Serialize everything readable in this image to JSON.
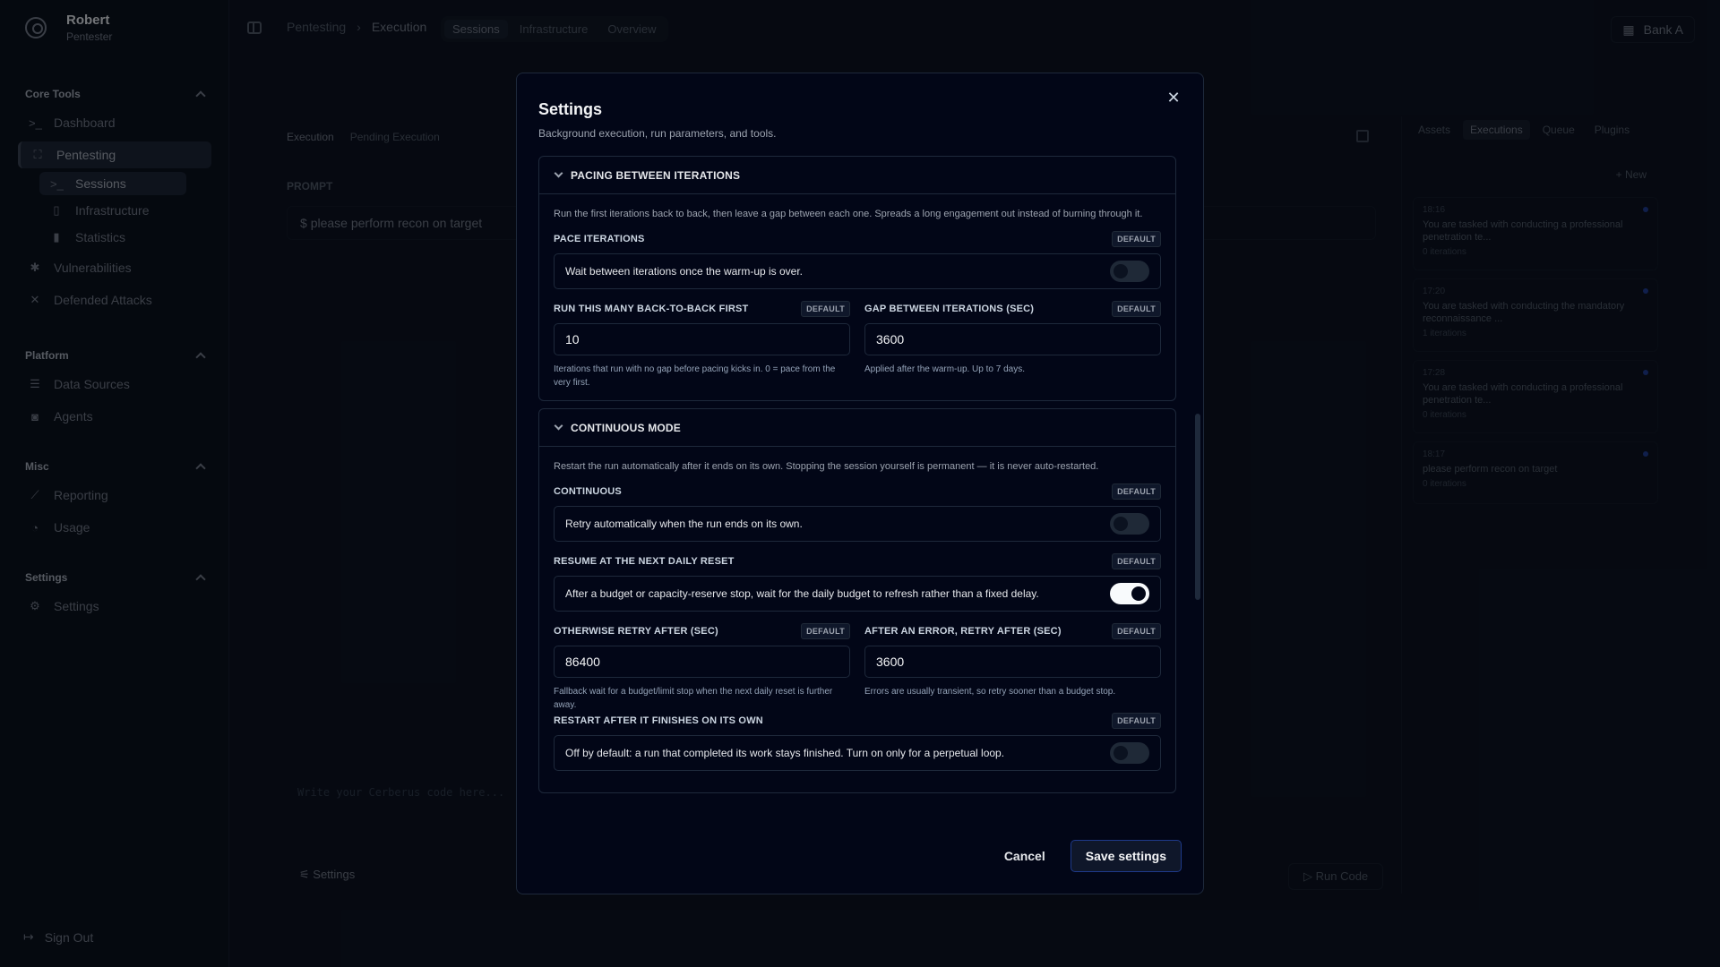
{
  "user": {
    "name": "Robert",
    "role": "Pentester"
  },
  "sidebar": {
    "core_tools": {
      "title": "Core Tools",
      "items": [
        "Dashboard",
        "Pentesting"
      ],
      "sub_items": [
        "Sessions",
        "Infrastructure",
        "Statistics"
      ],
      "more_items": [
        "Vulnerabilities",
        "Defended Attacks"
      ]
    },
    "platform": {
      "title": "Platform",
      "items": [
        "Data Sources",
        "Agents"
      ]
    },
    "misc": {
      "title": "Misc",
      "items": [
        "Reporting",
        "Usage"
      ]
    },
    "settings": {
      "title": "Settings",
      "items": [
        "Settings"
      ]
    },
    "sign_out": "Sign Out"
  },
  "topbar": {
    "breadcrumb": [
      "Pentesting",
      "Execution"
    ],
    "tabs": [
      "Sessions",
      "Infrastructure",
      "Overview"
    ],
    "org": "Bank A"
  },
  "execution": {
    "tabs": [
      "Execution",
      "Pending Execution"
    ],
    "prompt_label": "PROMPT",
    "prompt_value": "please perform recon on target",
    "code_placeholder": "Write your Cerberus code here...",
    "settings_label": "Settings",
    "run_code_label": "Run Code"
  },
  "right_panel": {
    "tabs": [
      "Assets",
      "Executions",
      "Queue",
      "Plugins"
    ],
    "new_label": "New",
    "cards": [
      {
        "time": "18:16",
        "text": "You are tasked with conducting a professional penetration te...",
        "iterations": "0 iterations"
      },
      {
        "time": "17:20",
        "text": "You are tasked with conducting the mandatory reconnaissance ...",
        "iterations": "1 iterations"
      },
      {
        "time": "17:28",
        "text": "You are tasked with conducting a professional penetration te...",
        "iterations": "0 iterations"
      },
      {
        "time": "18:17",
        "text": "please perform recon on target",
        "iterations": "0 iterations"
      }
    ]
  },
  "modal": {
    "title": "Settings",
    "subtitle": "Background execution, run parameters, and tools.",
    "default_badge": "DEFAULT",
    "pacing": {
      "title": "PACING BETWEEN ITERATIONS",
      "description": "Run the first iterations back to back, then leave a gap between each one. Spreads a long engagement out instead of burning through it.",
      "pace_label": "PACE ITERATIONS",
      "pace_text": "Wait between iterations once the warm-up is over.",
      "pace_on": false,
      "burst_label": "RUN THIS MANY BACK-TO-BACK FIRST",
      "burst_value": "10",
      "burst_help": "Iterations that run with no gap before pacing kicks in. 0 = pace from the very first.",
      "gap_label": "GAP BETWEEN ITERATIONS (SEC)",
      "gap_value": "3600",
      "gap_help": "Applied after the warm-up. Up to 7 days."
    },
    "continuous": {
      "title": "CONTINUOUS MODE",
      "description": "Restart the run automatically after it ends on its own. Stopping the session yourself is permanent — it is never auto-restarted.",
      "continuous_label": "CONTINUOUS",
      "continuous_text": "Retry automatically when the run ends on its own.",
      "continuous_on": false,
      "resume_label": "RESUME AT THE NEXT DAILY RESET",
      "resume_text": "After a budget or capacity-reserve stop, wait for the daily budget to refresh rather than a fixed delay.",
      "resume_on": true,
      "retry_label": "OTHERWISE RETRY AFTER (SEC)",
      "retry_value": "86400",
      "retry_help": "Fallback wait for a budget/limit stop when the next daily reset is further away.",
      "error_label": "AFTER AN ERROR, RETRY AFTER (SEC)",
      "error_value": "3600",
      "error_help": "Errors are usually transient, so retry sooner than a budget stop.",
      "restart_label": "RESTART AFTER IT FINISHES ON ITS OWN",
      "restart_text": "Off by default: a run that completed its work stays finished. Turn on only for a perpetual loop.",
      "restart_on": false
    },
    "cancel_label": "Cancel",
    "save_label": "Save settings"
  }
}
